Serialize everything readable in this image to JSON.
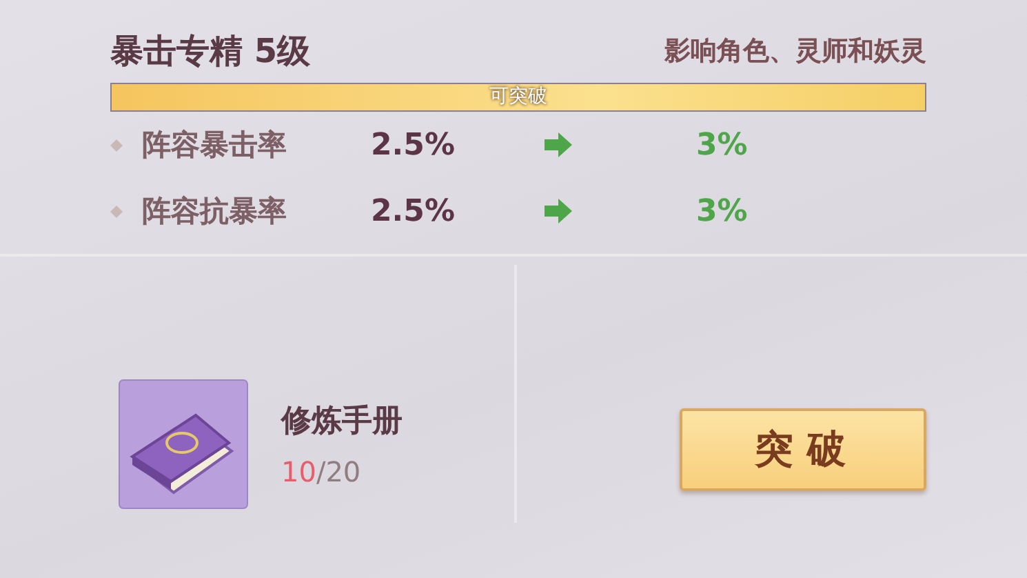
{
  "skill": {
    "title": "暴击专精 5级",
    "scope": "影响角色、灵师和妖灵"
  },
  "progress": {
    "label": "可突破",
    "level": 1
  },
  "stats": [
    {
      "name": "阵容暴击率",
      "current": "2.5%",
      "next": "3%"
    },
    {
      "name": "阵容抗暴率",
      "current": "2.5%",
      "next": "3%"
    }
  ],
  "material": {
    "name": "修炼手册",
    "owned": "10",
    "required": "/20",
    "sufficient": false
  },
  "button": {
    "label": "突破"
  }
}
